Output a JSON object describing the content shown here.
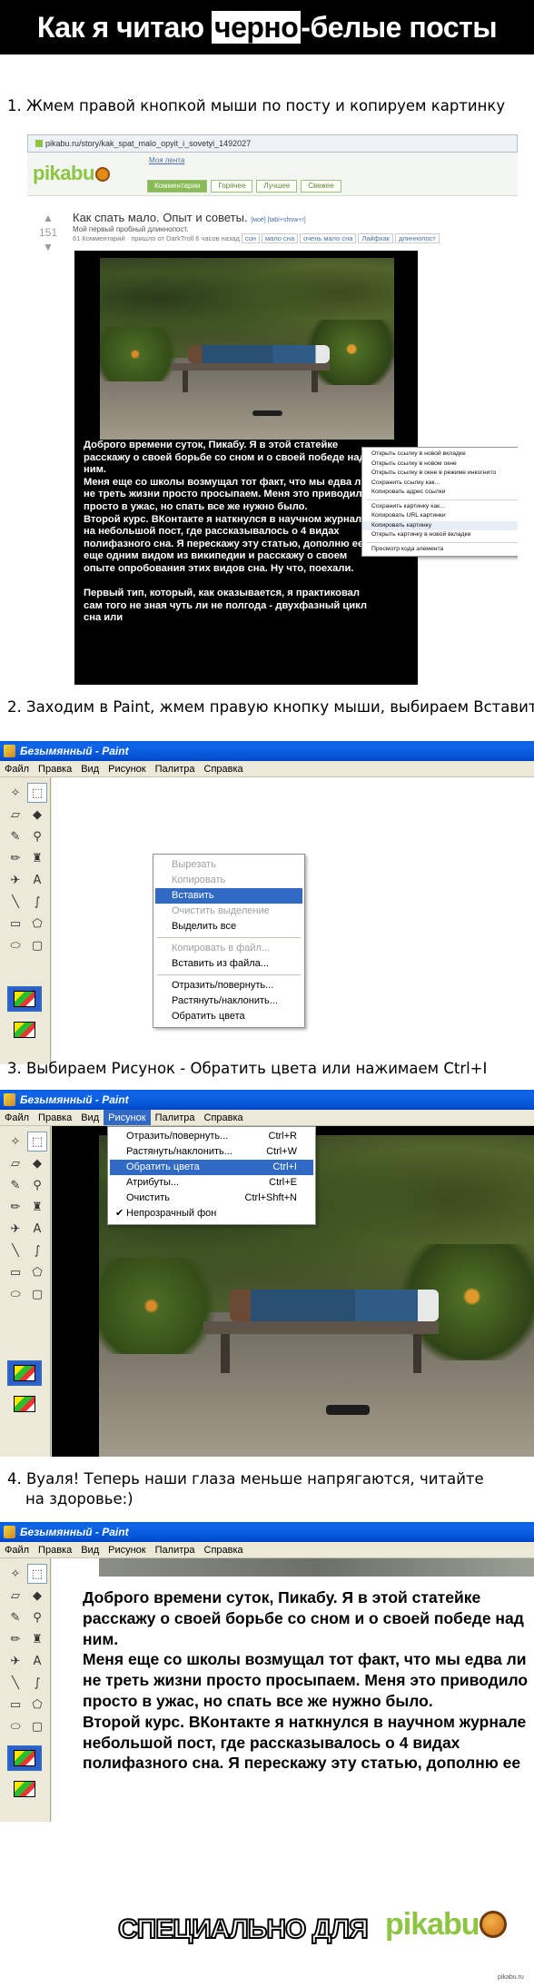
{
  "header": {
    "title_pre": "Как я читаю ",
    "title_highlight": "черно",
    "title_post": "-белые посты"
  },
  "steps": [
    "1. Жмем правой кнопкой мыши по посту и копируем картинку",
    "2. Заходим в Paint, жмем правую кнопку мыши, выбираем Вставить",
    "3. Выбираем Рисунок - Обратить цвета или нажимаем Ctrl+I",
    "4. Вуаля! Теперь наши глаза меньше напрягаются, читайте",
    "на здоровье:)"
  ],
  "browser": {
    "url": "pikabu.ru/story/kak_spat_malo_opyit_i_sovetyi_1492027",
    "logo": "pikabu",
    "my_tape": "Моя лента",
    "tabs": [
      "Комментарии",
      "Горячее",
      "Лучшее",
      "Свежее"
    ],
    "score": "151",
    "post_title": "Как спать мало. Опыт и советы.",
    "post_title_tags": "[моё] [tabl+show+r]",
    "post_subtitle": "Мой первый пробный длиннопост.",
    "post_meta": "61 Комментарий · пришло от DarkTroll 6 часов назад",
    "post_tags": [
      "сон",
      "мало сна",
      "очень мало сна",
      "Лайфхак",
      "длиннопост"
    ],
    "post_text": "Доброго времени суток, Пикабу. Я в этой статейке расскажу о своей борьбе со сном и о своей победе над ним.\nМеня еще со школы возмущал тот факт, что мы едва ли не треть жизни просто просыпаем. Меня это приводило просто в ужас, но спать все же нужно было.\nВторой курс. ВКонтакте я наткнулся в научном журнале на небольшой пост, где рассказывалось о 4 видах полифазного сна. Я перескажу эту статью, дополню ее еще одним видом из википедии и расскажу о своем опыте опробования этих видов сна. Ну что, поехали.\n\nПервый тип, который, как оказывается, я практиковал сам того не зная чуть ли не полгода - двухфазный цикл сна или",
    "context_menu": [
      "Открыть ссылку в новой вкладке",
      "Открыть ссылку в новом окне",
      "Открыть ссылку в окне в режиме инкогнито",
      "Сохранить ссылку как...",
      "Копировать адрес ссылки",
      "Сохранить картинку как...",
      "Копировать URL картинки",
      "Копировать картинку",
      "Открыть картинку в новой вкладке",
      "Просмотр кода элемента"
    ]
  },
  "paint": {
    "title": "Безымянный - Paint",
    "menu": [
      "Файл",
      "Правка",
      "Вид",
      "Рисунок",
      "Палитра",
      "Справка"
    ],
    "edit_menu": [
      "Вырезать",
      "Копировать",
      "Вставить",
      "Очистить выделение",
      "Выделить все",
      "Копировать в файл...",
      "Вставить из файла...",
      "Отразить/повернуть...",
      "Растянуть/наклонить...",
      "Обратить цвета"
    ],
    "image_menu": [
      {
        "label": "Отразить/повернуть...",
        "key": "Ctrl+R"
      },
      {
        "label": "Растянуть/наклонить...",
        "key": "Ctrl+W"
      },
      {
        "label": "Обратить цвета",
        "key": "Ctrl+I"
      },
      {
        "label": "Атрибуты...",
        "key": "Ctrl+E"
      },
      {
        "label": "Очистить",
        "key": "Ctrl+Shft+N"
      },
      {
        "label": "Непрозрачный фон",
        "key": ""
      }
    ],
    "inverted_text": "Доброго времени суток, Пикабу. Я в этой статейке\nрасскажу о своей борьбе со сном и о своей победе над\nним.\nМеня еще со школы возмущал тот факт, что мы едва ли\nне треть жизни просто просыпаем. Меня это приводило\nпросто в ужас, но спать все же нужно было.\nВторой курс. ВКонтакте я наткнулся в научном журнале\nнебольшой пост, где рассказывалось о 4 видах\nполифазного сна. Я перескажу эту статью, дополню ее"
  },
  "footer": {
    "special": "СПЕЦИАЛЬНО ДЛЯ",
    "logo": "pikabu",
    "watermark": "pikabu.ru"
  }
}
